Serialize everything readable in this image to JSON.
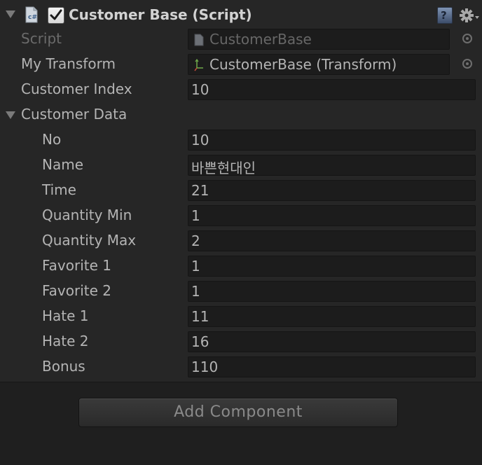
{
  "component": {
    "title": "Customer Base (Script)",
    "enabled": true,
    "icons": [
      "script-icon",
      "checkbox-checked-icon",
      "help-icon",
      "gear-icon"
    ]
  },
  "fields": {
    "script": {
      "label": "Script",
      "value": "CustomerBase"
    },
    "my_transform": {
      "label": "My Transform",
      "value": "CustomerBase (Transform)"
    },
    "customer_index": {
      "label": "Customer Index",
      "value": "10"
    },
    "customer_data": {
      "label": "Customer Data"
    }
  },
  "customer_data": [
    {
      "label": "No",
      "value": "10"
    },
    {
      "label": "Name",
      "value": "바쁜현대인"
    },
    {
      "label": "Time",
      "value": "21"
    },
    {
      "label": "Quantity Min",
      "value": "1"
    },
    {
      "label": "Quantity Max",
      "value": "2"
    },
    {
      "label": "Favorite 1",
      "value": "1"
    },
    {
      "label": "Favorite 2",
      "value": "1"
    },
    {
      "label": "Hate 1",
      "value": "11"
    },
    {
      "label": "Hate 2",
      "value": "16"
    },
    {
      "label": "Bonus",
      "value": "110"
    }
  ],
  "add_component": {
    "label": "Add Component"
  }
}
